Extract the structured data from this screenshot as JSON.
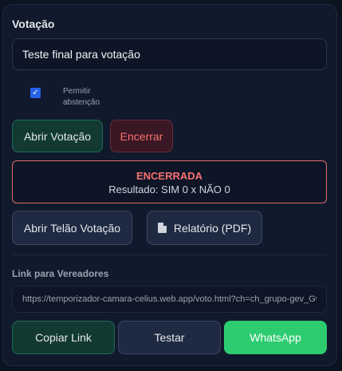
{
  "voting": {
    "section_title": "Votação",
    "title_value": "Teste final para votação",
    "abstention": {
      "checked": true,
      "label": "Permitir abstenção"
    },
    "open_label": "Abrir Votação",
    "close_label": "Encerrar"
  },
  "status": {
    "state": "ENCERRADA",
    "result": "Resultado: SIM 0 x NÃO 0"
  },
  "actions": {
    "screen_label": "Abrir Telão Votação",
    "report_label": "Relatório (PDF)"
  },
  "link": {
    "section_title": "Link para Vereadores",
    "url": "https://temporizador-camara-celius.web.app/voto.html?ch=ch_grupo-gev_Gw",
    "copy_label": "Copiar Link",
    "test_label": "Testar",
    "whatsapp_label": "WhatsApp"
  },
  "colors": {
    "accent_green": "#2ecc71",
    "danger_red": "#f87171",
    "checkbox_blue": "#2563eb"
  }
}
